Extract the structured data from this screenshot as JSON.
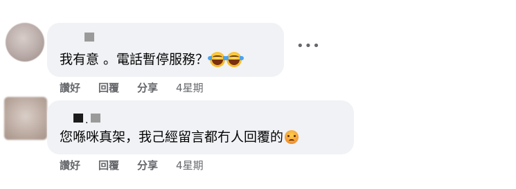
{
  "comments": [
    {
      "text": "我有意 。電話暫停服務？",
      "emojis": [
        "laughing-tears",
        "laughing-tears"
      ],
      "actions": {
        "like": "讚好",
        "reply": "回覆",
        "share": "分享",
        "time": "4星期"
      }
    },
    {
      "text": "您喺咪真架，我己經留言都冇人回覆的",
      "emojis": [
        "angry"
      ],
      "actions": {
        "like": "讚好",
        "reply": "回覆",
        "share": "分享",
        "time": "4星期"
      }
    }
  ],
  "more_icon_label": "•••",
  "name_separator": "."
}
